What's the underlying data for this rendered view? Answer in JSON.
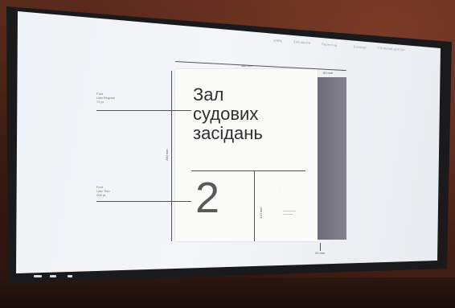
{
  "scene": {
    "toolbar": [
      "100%",
      "Заповнити",
      "Перегляд",
      "Експорт",
      "Спільний доступ"
    ],
    "annotations": {
      "top": [
        "Font",
        "Lato Regular",
        "72 pt"
      ],
      "bottom": [
        "Font",
        "Lato Thin",
        "200 pt"
      ]
    },
    "dimensions": {
      "width": "380 mm",
      "strip": "50 mm",
      "height": "280 mm",
      "gap": "120 mm",
      "bottom": "20 mm"
    },
    "sign": {
      "title_lines": [
        "Зал",
        "судових",
        "засідань"
      ],
      "number": "2"
    },
    "colors": {
      "wall": "#4a2418",
      "screen": "#eef1f5",
      "strip": "#7a7886",
      "text": "#2f2f2f"
    }
  }
}
